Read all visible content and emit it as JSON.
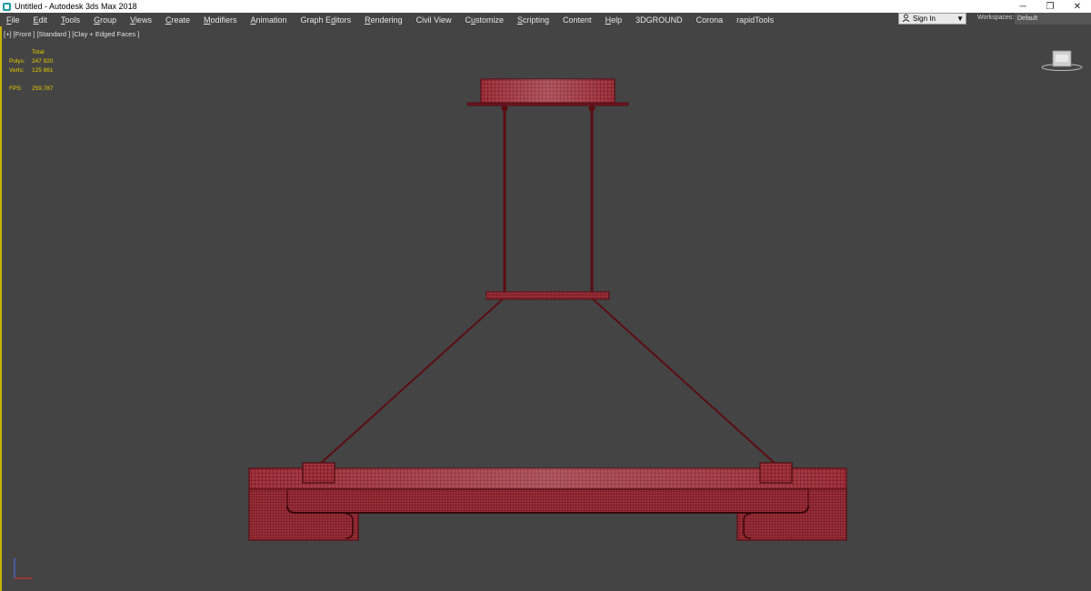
{
  "window": {
    "title": "Untitled - Autodesk 3ds Max 2018",
    "controls": [
      "─",
      "❐",
      "✕"
    ]
  },
  "menu": [
    {
      "pre": "",
      "mn": "F",
      "post": "ile"
    },
    {
      "pre": "",
      "mn": "E",
      "post": "dit"
    },
    {
      "pre": "",
      "mn": "T",
      "post": "ools"
    },
    {
      "pre": "",
      "mn": "G",
      "post": "roup"
    },
    {
      "pre": "",
      "mn": "V",
      "post": "iews"
    },
    {
      "pre": "",
      "mn": "C",
      "post": "reate"
    },
    {
      "pre": "",
      "mn": "M",
      "post": "odifiers"
    },
    {
      "pre": "",
      "mn": "A",
      "post": "nimation"
    },
    {
      "pre": "Graph E",
      "mn": "d",
      "post": "itors"
    },
    {
      "pre": "",
      "mn": "R",
      "post": "endering"
    },
    {
      "pre": "Civil View",
      "mn": "",
      "post": ""
    },
    {
      "pre": "C",
      "mn": "u",
      "post": "stomize"
    },
    {
      "pre": "",
      "mn": "S",
      "post": "cripting"
    },
    {
      "pre": "Content",
      "mn": "",
      "post": ""
    },
    {
      "pre": "",
      "mn": "H",
      "post": "elp"
    },
    {
      "pre": "3DGROUND",
      "mn": "",
      "post": ""
    },
    {
      "pre": "Corona",
      "mn": "",
      "post": ""
    },
    {
      "pre": "rapidTools",
      "mn": "",
      "post": ""
    }
  ],
  "signin": {
    "label": "Sign In",
    "icon": "user-icon"
  },
  "workspaces": {
    "label": "Workspaces:",
    "value": "Default"
  },
  "viewport": {
    "label": "[+] [Front ] [Standard ] [Clay + Edged Faces ]",
    "stats": {
      "header": "Total",
      "polys_label": "Polys:",
      "polys_value": "247 920",
      "verts_label": "Verts:",
      "verts_value": "125 861",
      "fps_label": "FPS:",
      "fps_value": "259,787"
    }
  },
  "colors": {
    "viewport_bg": "#444444",
    "wire": "#5a0d14",
    "mesh_fill": "#a3333e",
    "stats_text": "#e6cc00",
    "active_border": "#c8b400"
  }
}
